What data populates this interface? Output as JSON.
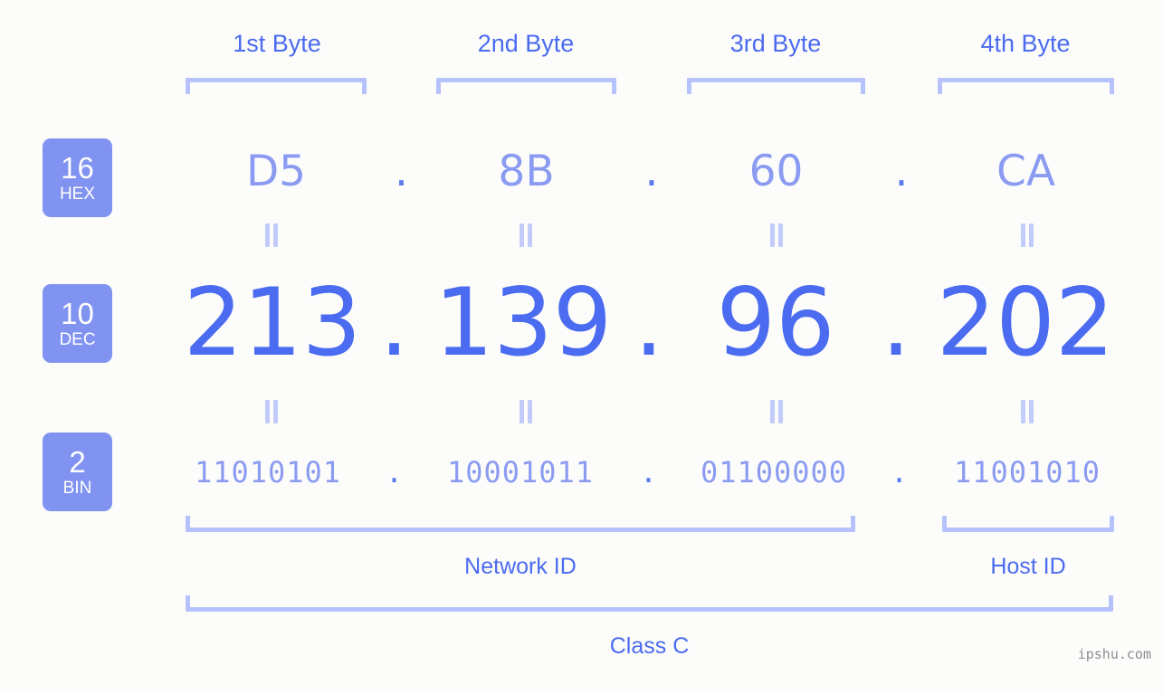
{
  "page": {
    "background_color": "#fcfdfa",
    "accent_strong": "#4b6bf0",
    "accent_light": "#8b9bf2",
    "bracket_color": "#b6c2fb",
    "badge_color": "#8093f0"
  },
  "byte_headers": [
    {
      "label": "1st Byte"
    },
    {
      "label": "2nd Byte"
    },
    {
      "label": "3rd Byte"
    },
    {
      "label": "4th Byte"
    }
  ],
  "bases": [
    {
      "number": "16",
      "name": "HEX"
    },
    {
      "number": "10",
      "name": "DEC"
    },
    {
      "number": "2",
      "name": "BIN"
    }
  ],
  "separator": ".",
  "rows": {
    "hex": {
      "values": [
        "D5",
        "8B",
        "60",
        "CA"
      ]
    },
    "dec": {
      "values": [
        "213",
        "139",
        "96",
        "202"
      ]
    },
    "bin": {
      "values": [
        "11010101",
        "10001011",
        "01100000",
        "11001010"
      ]
    }
  },
  "equals_symbol": "=",
  "sections": [
    {
      "label": "Network ID"
    },
    {
      "label": "Host ID"
    }
  ],
  "class_label": "Class C",
  "watermark": "ipshu.com"
}
